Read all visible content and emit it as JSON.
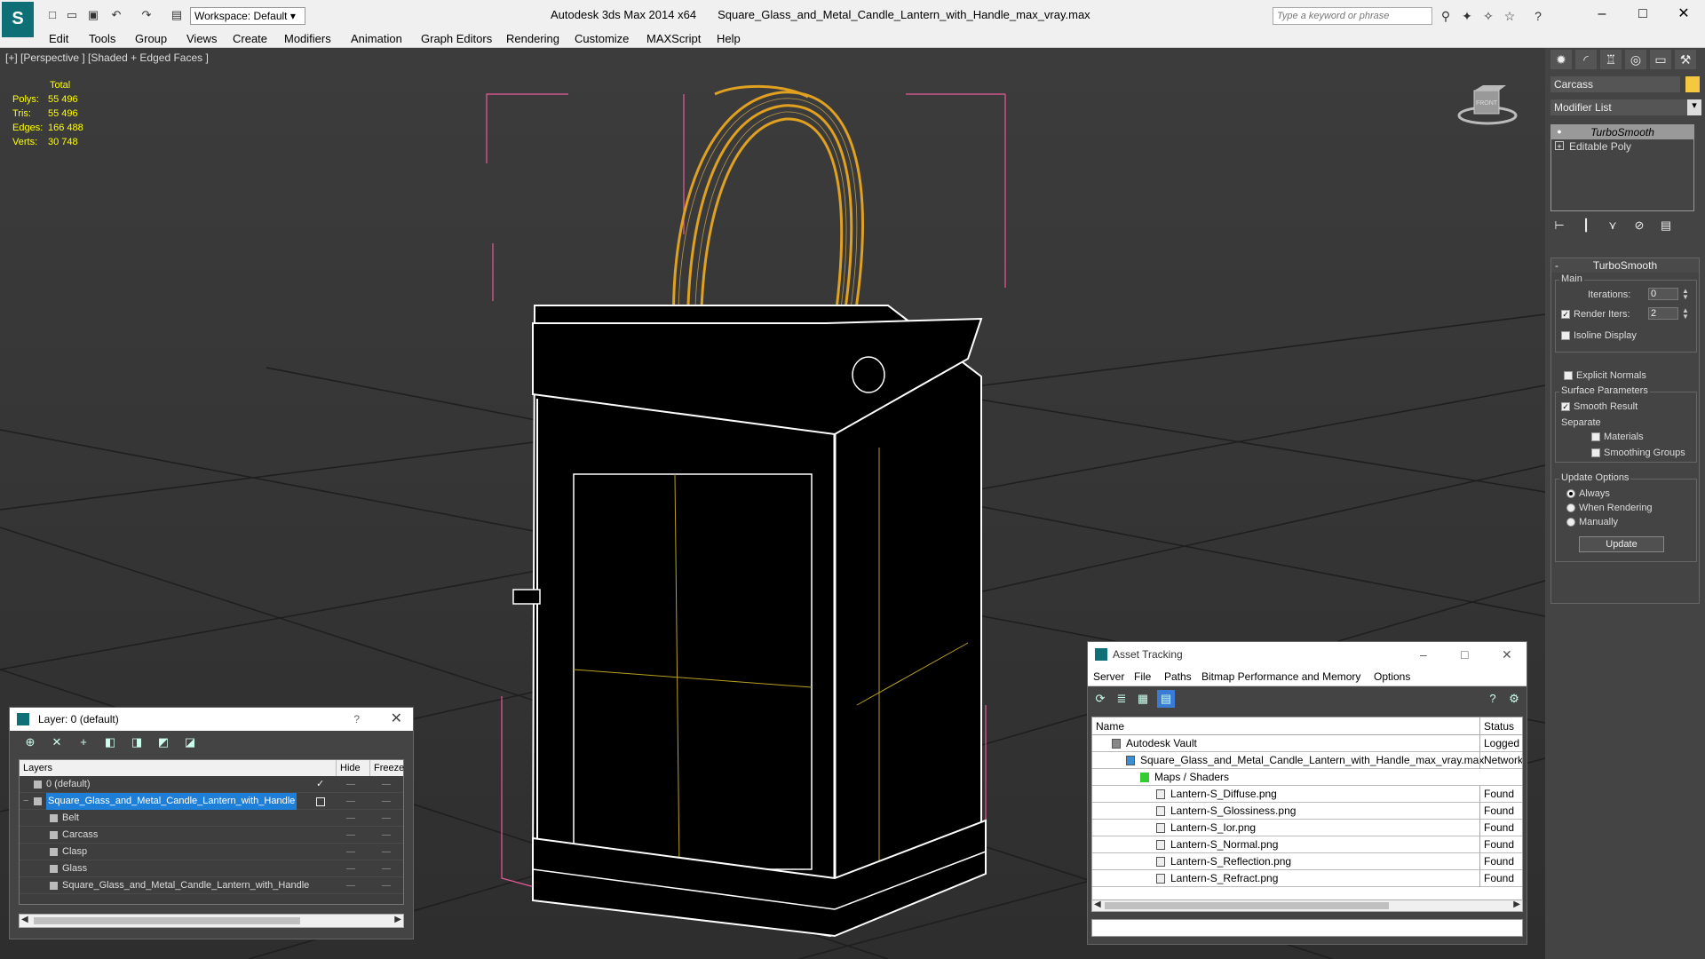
{
  "app": {
    "workspace": "Workspace: Default",
    "title_app": "Autodesk 3ds Max  2014 x64",
    "title_file": "Square_Glass_and_Metal_Candle_Lantern_with_Handle_max_vray.max",
    "search_placeholder": "Type a keyword or phrase"
  },
  "menu": [
    "Edit",
    "Tools",
    "Group",
    "Views",
    "Create",
    "Modifiers",
    "Animation",
    "Graph Editors",
    "Rendering",
    "Customize",
    "MAXScript",
    "Help"
  ],
  "viewport": {
    "label": "[+] [Perspective ] [Shaded + Edged Faces ]",
    "stats": {
      "total_label": "Total",
      "rows": [
        {
          "k": "Polys:",
          "v": "55 496"
        },
        {
          "k": "Tris:",
          "v": "55 496"
        },
        {
          "k": "Edges:",
          "v": "166 488"
        },
        {
          "k": "Verts:",
          "v": "30 748"
        }
      ]
    }
  },
  "command_panel": {
    "object_name": "Carcass",
    "object_color": "#f5c842",
    "modifier_list": "Modifier List",
    "stack": [
      "TurboSmooth",
      "Editable Poly"
    ],
    "rollout_title": "TurboSmooth",
    "main_group": "Main",
    "iterations_label": "Iterations:",
    "iterations_value": "0",
    "render_iters_label": "Render Iters:",
    "render_iters_value": "2",
    "isoline": "Isoline Display",
    "explicit_normals": "Explicit Normals",
    "surface_group": "Surface Parameters",
    "smooth_result": "Smooth Result",
    "separate": "Separate",
    "materials": "Materials",
    "smoothing_groups": "Smoothing Groups",
    "update_group": "Update Options",
    "always": "Always",
    "when_rendering": "When Rendering",
    "manually": "Manually",
    "update_btn": "Update"
  },
  "layer_window": {
    "title": "Layer: 0 (default)",
    "help": "?",
    "col_layers": "Layers",
    "col_hide": "Hide",
    "col_freeze": "Freeze",
    "rows": [
      {
        "name": "0 (default)",
        "indent": 1
      },
      {
        "name": "Square_Glass_and_Metal_Candle_Lantern_with_Handle",
        "indent": 1,
        "selected": true
      },
      {
        "name": "Belt",
        "indent": 2
      },
      {
        "name": "Carcass",
        "indent": 2
      },
      {
        "name": "Clasp",
        "indent": 2
      },
      {
        "name": "Glass",
        "indent": 2
      },
      {
        "name": "Square_Glass_and_Metal_Candle_Lantern_with_Handle",
        "indent": 2
      }
    ],
    "dash": "—"
  },
  "asset_tracking": {
    "title": "Asset Tracking",
    "menu": [
      "Server",
      "File",
      "Paths",
      "Bitmap Performance and Memory",
      "Options"
    ],
    "col_name": "Name",
    "col_status": "Status",
    "rows": [
      {
        "name": "Autodesk Vault",
        "status": "Logged Out",
        "indent": 0
      },
      {
        "name": "Square_Glass_and_Metal_Candle_Lantern_with_Handle_max_vray.max",
        "status": "Network",
        "indent": 1
      },
      {
        "name": "Maps / Shaders",
        "status": "",
        "indent": 2
      },
      {
        "name": "Lantern-S_Diffuse.png",
        "status": "Found",
        "indent": 3
      },
      {
        "name": "Lantern-S_Glossiness.png",
        "status": "Found",
        "indent": 3
      },
      {
        "name": "Lantern-S_Ior.png",
        "status": "Found",
        "indent": 3
      },
      {
        "name": "Lantern-S_Normal.png",
        "status": "Found",
        "indent": 3
      },
      {
        "name": "Lantern-S_Reflection.png",
        "status": "Found",
        "indent": 3
      },
      {
        "name": "Lantern-S_Refract.png",
        "status": "Found",
        "indent": 3
      }
    ]
  },
  "viewcube_label": "FRONT"
}
